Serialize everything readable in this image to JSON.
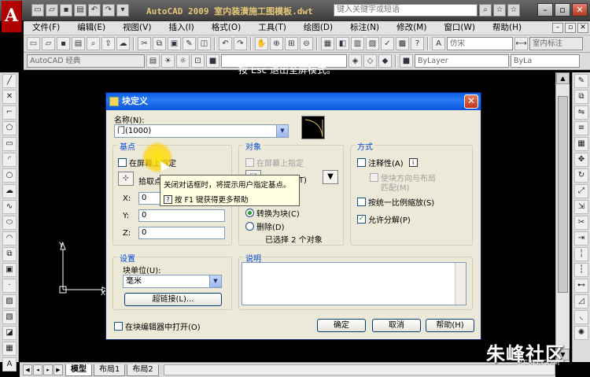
{
  "app": {
    "logo": "A",
    "title": "AutoCAD 2009  室内装潢施工图模板.dwt",
    "search_placeholder": "键入关键字或短语"
  },
  "menu": [
    "文件(F)",
    "编辑(E)",
    "视图(V)",
    "插入(I)",
    "格式(O)",
    "工具(T)",
    "绘图(D)",
    "标注(N)",
    "修改(M)",
    "窗口(W)",
    "帮助(H)"
  ],
  "toolbar": {
    "font_select": "仿宋",
    "style_select": "室内标注",
    "workspace_select": "AutoCAD 经典",
    "layer_select": "ByLayer",
    "linetype_select": "ByLa"
  },
  "notice": "按 Esc 退出全屏模式。",
  "dialog": {
    "title": "块定义",
    "name_label": "名称(N):",
    "name_value": "门(1000)",
    "base": {
      "title": "基点",
      "onscreen": "在屏幕上指定",
      "pick": "拾取点(K)",
      "x_label": "X:",
      "x_value": "0",
      "y_label": "Y:",
      "y_value": "0",
      "z_label": "Z:",
      "z_value": "0"
    },
    "objects": {
      "title": "对象",
      "onscreen": "在屏幕上指定",
      "select": "选择对象(T)",
      "convert": "转换为块(C)",
      "delete": "删除(D)",
      "selected": "已选择 2 个对象"
    },
    "method": {
      "title": "方式",
      "annotative": "注释性(A)",
      "match_line1": "使块方向与布局",
      "match_line2": "匹配(M)",
      "uniform": "按统一比例缩放(S)",
      "explode": "允许分解(P)"
    },
    "settings": {
      "title": "设置",
      "unit_label": "块单位(U):",
      "unit_value": "毫米",
      "hyperlink": "超链接(L)..."
    },
    "description": {
      "title": "说明"
    },
    "open_editor": "在块编辑器中打开(O)",
    "ok": "确定",
    "cancel": "取消",
    "help": "帮助(H)"
  },
  "tooltip": {
    "line1": "关闭对话框时，将提示用户指定基点。",
    "line2": "按 F1 键获得更多帮助"
  },
  "ucs": {
    "x": "X",
    "y": "Y"
  },
  "tabs": [
    "模型",
    "布局1",
    "布局2"
  ],
  "watermark": "朱峰社区",
  "watermark_sub": "ZF3D.COM"
}
